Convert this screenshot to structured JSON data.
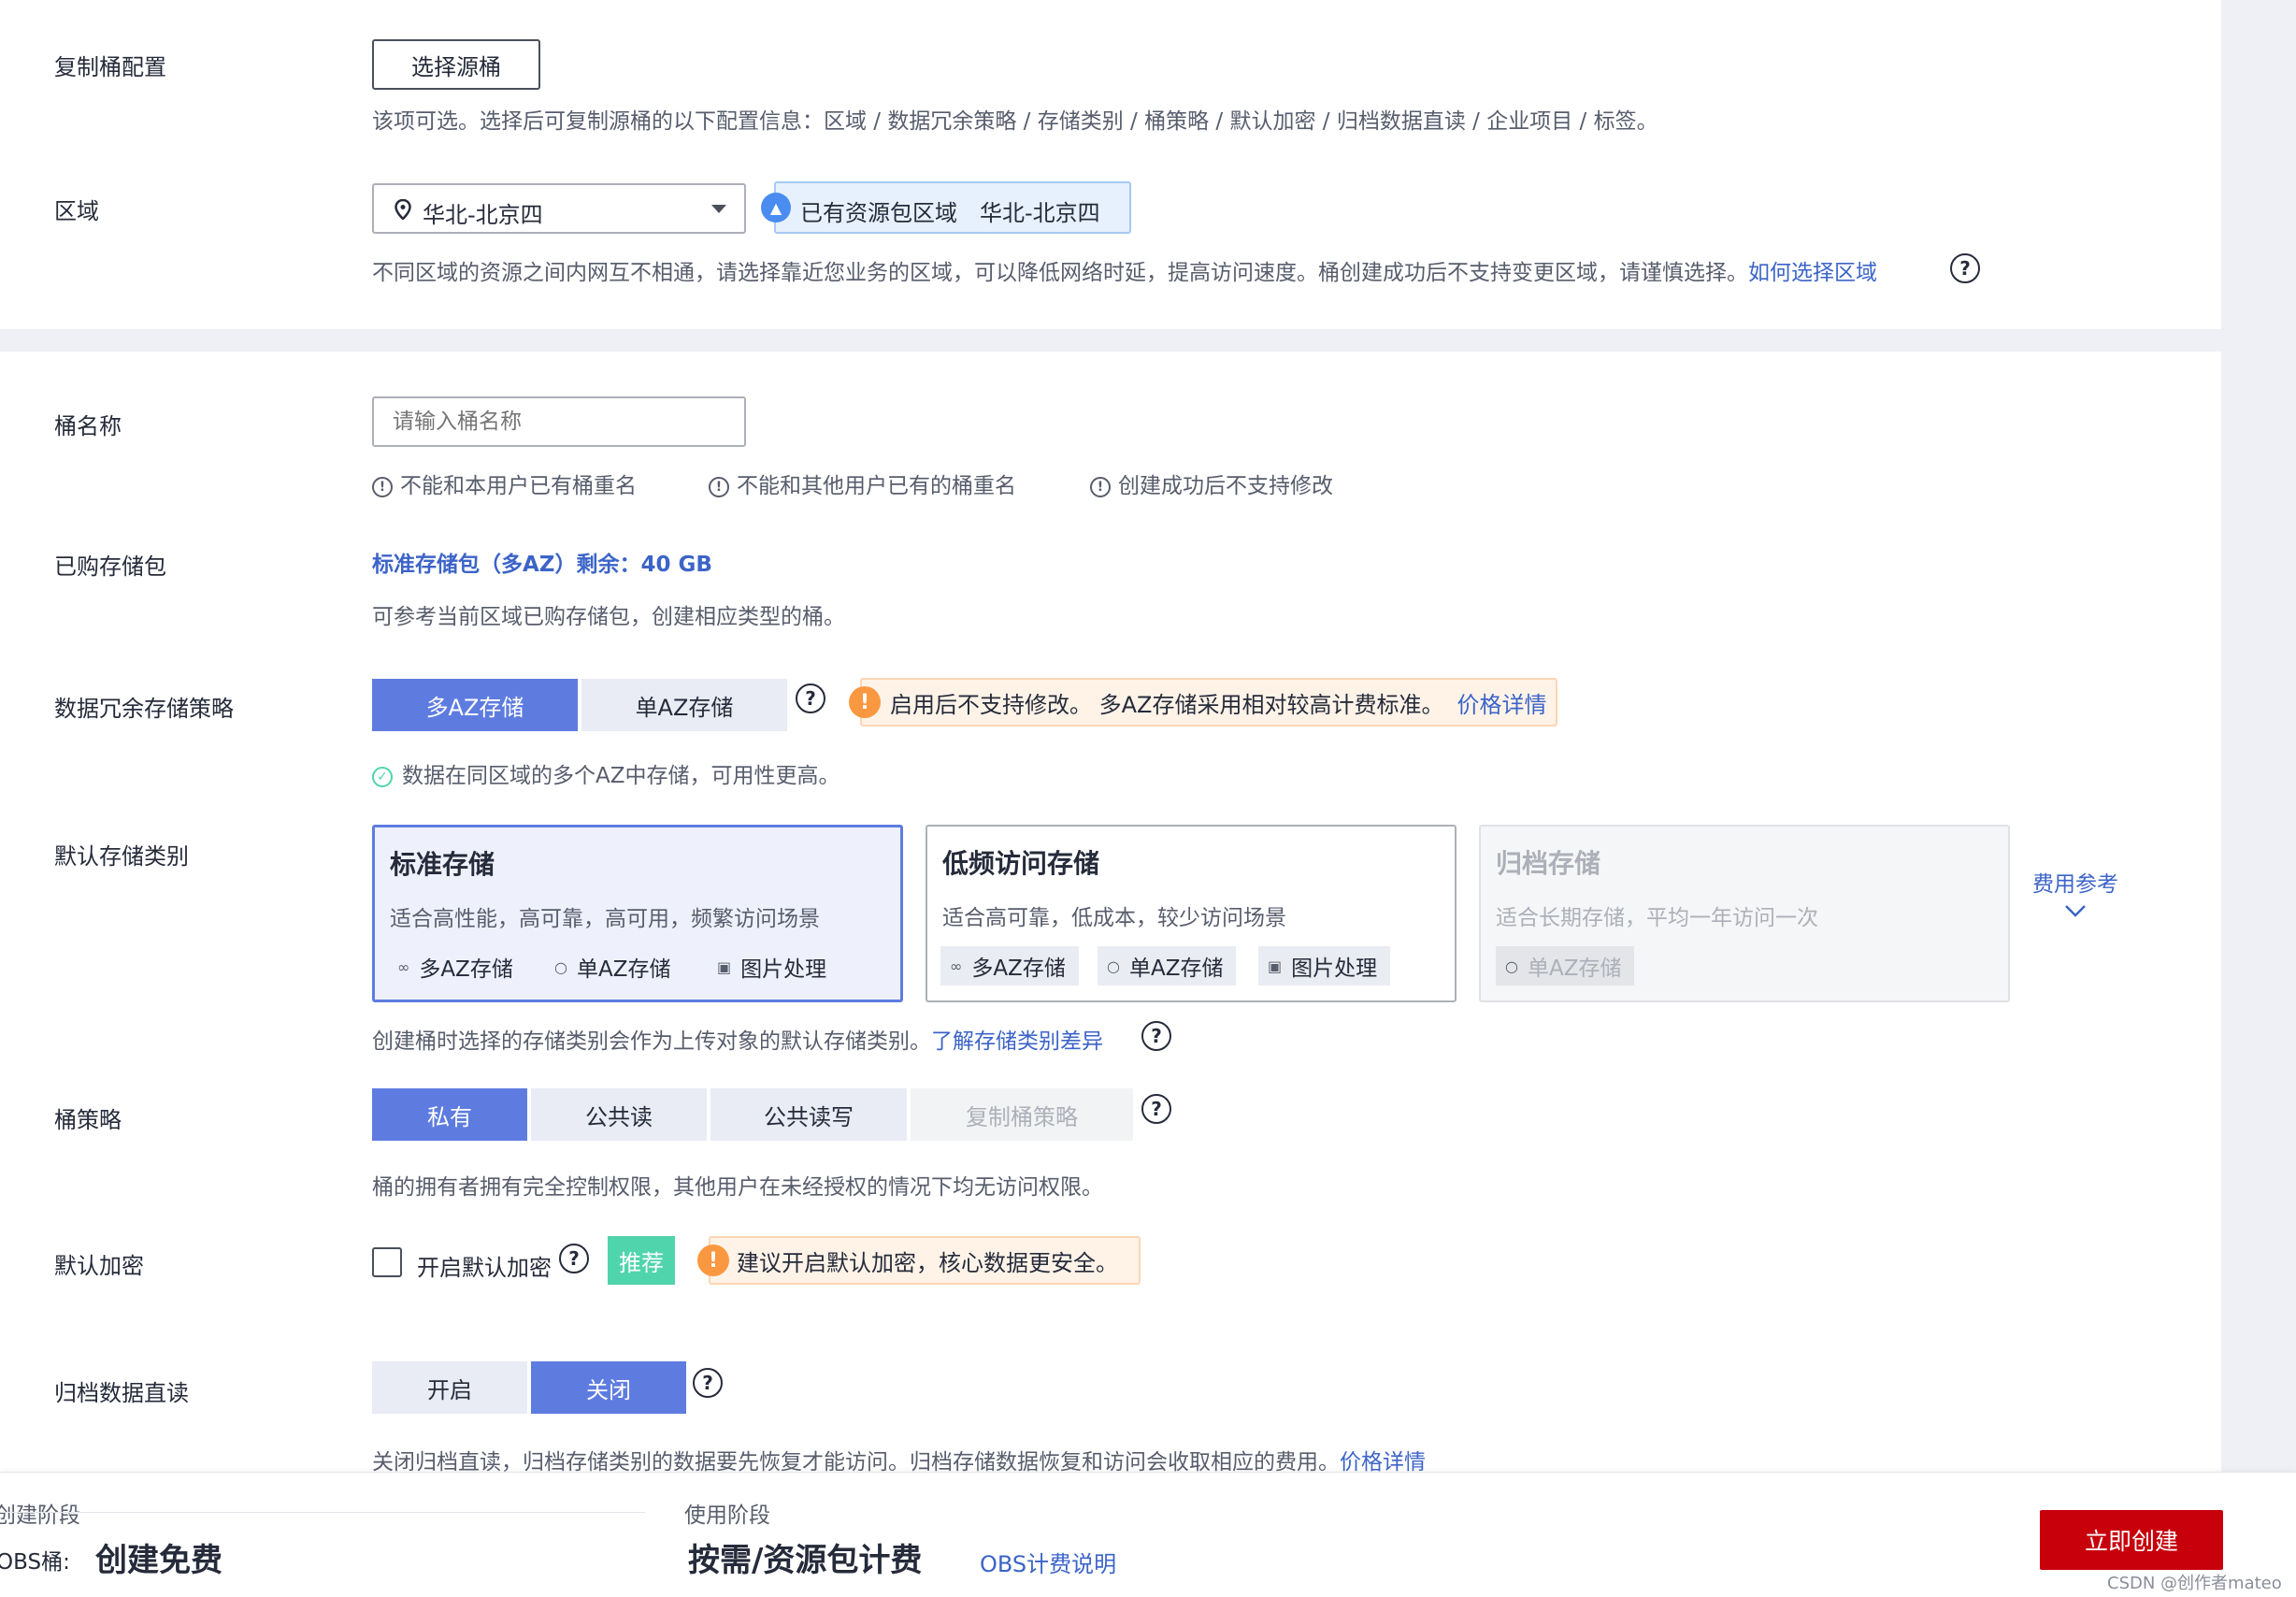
{
  "replicate": {
    "label": "复制桶配置",
    "button": "选择源桶",
    "hint": "该项可选。选择后可复制源桶的以下配置信息：区域 / 数据冗余策略 / 存储类别 / 桶策略 / 默认加密 / 归档数据直读 / 企业项目 / 标签。"
  },
  "region": {
    "label": "区域",
    "selected": "华北-北京四",
    "resource_tag": "已有资源包区域",
    "resource_region": "华北-北京四",
    "hint": "不同区域的资源之间内网互不相通，请选择靠近您业务的区域，可以降低网络时延，提高访问速度。桶创建成功后不支持变更区域，请谨慎选择。",
    "help_link": "如何选择区域"
  },
  "bucket_name": {
    "label": "桶名称",
    "placeholder": "请输入桶名称",
    "rules": [
      "不能和本用户已有桶重名",
      "不能和其他用户已有的桶重名",
      "创建成功后不支持修改"
    ]
  },
  "package": {
    "label": "已购存储包",
    "value": "标准存储包（多AZ）剩余：40 GB",
    "hint": "可参考当前区域已购存储包，创建相应类型的桶。"
  },
  "redundancy": {
    "label": "数据冗余存储策略",
    "options": [
      "多AZ存储",
      "单AZ存储"
    ],
    "selected": "多AZ存储",
    "warning": "启用后不支持修改。 多AZ存储采用相对较高计费标准。",
    "warning_link": "价格详情",
    "success_hint": "数据在同区域的多个AZ中存储，可用性更高。"
  },
  "storage_class": {
    "label": "默认存储类别",
    "cards": [
      {
        "title": "标准存储",
        "desc": "适合高性能，高可靠，高可用，频繁访问场景",
        "tags": [
          "多AZ存储",
          "单AZ存储",
          "图片处理"
        ],
        "state": "selected"
      },
      {
        "title": "低频访问存储",
        "desc": "适合高可靠，低成本，较少访问场景",
        "tags": [
          "多AZ存储",
          "单AZ存储",
          "图片处理"
        ],
        "state": "normal"
      },
      {
        "title": "归档存储",
        "desc": "适合长期存储，平均一年访问一次",
        "tags": [
          "单AZ存储"
        ],
        "state": "disabled"
      }
    ],
    "fee_link": "费用参考",
    "hint": "创建桶时选择的存储类别会作为上传对象的默认存储类别。",
    "hint_link": "了解存储类别差异"
  },
  "policy": {
    "label": "桶策略",
    "options": [
      "私有",
      "公共读",
      "公共读写",
      "复制桶策略"
    ],
    "selected": "私有",
    "hint": "桶的拥有者拥有完全控制权限，其他用户在未经授权的情况下均无访问权限。"
  },
  "encryption": {
    "label": "默认加密",
    "checkbox_label": "开启默认加密",
    "checked": false,
    "badge": "推荐",
    "warning": "建议开启默认加密，核心数据更安全。"
  },
  "archive_read": {
    "label": "归档数据直读",
    "options": [
      "开启",
      "关闭"
    ],
    "selected": "关闭",
    "hint": "关闭归档直读，归档存储类别的数据要先恢复才能访问。归档存储数据恢复和访问会收取相应的费用。",
    "hint_link": "价格详情"
  },
  "footer": {
    "stage1_label": "创建阶段",
    "stage1_prefix": "OBS桶:",
    "stage1_value": "创建免费",
    "stage2_label": "使用阶段",
    "stage2_value": "按需/资源包计费",
    "billing_link": "OBS计费说明",
    "create_button": "立即创建",
    "watermark": "CSDN @创作者mateo"
  },
  "colors": {
    "primary": "#5e7ce0",
    "link": "#3c64c8",
    "create_button": "#c7000b",
    "warning": "#fa9841",
    "recommend": "#50d4ab"
  }
}
